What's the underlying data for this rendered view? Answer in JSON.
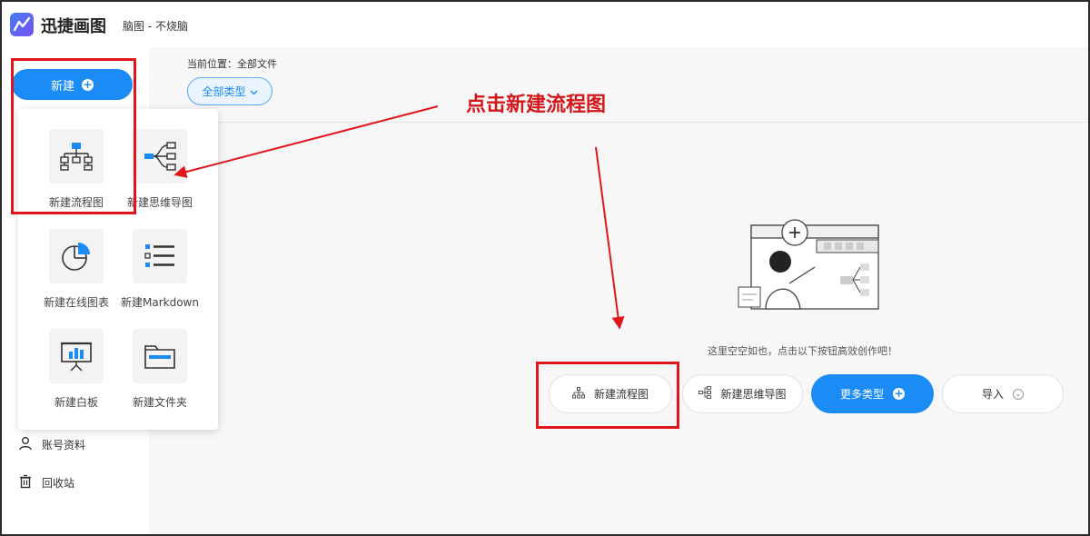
{
  "header": {
    "app_title": "迅捷画图",
    "doc_title": "脑图 - 不烧脑"
  },
  "sidebar": {
    "new_button": "新建",
    "account": "账号资料",
    "trash": "回收站"
  },
  "main": {
    "breadcrumb": "当前位置：全部文件",
    "type_filter": "全部类型",
    "empty_text": "这里空空如也，点击以下按钮高效创作吧！",
    "buttons": {
      "new_flowchart": "新建流程图",
      "new_mindmap": "新建思维导图",
      "more_types": "更多类型",
      "import": "导入"
    }
  },
  "menu": {
    "items": [
      {
        "label": "新建流程图",
        "icon": "flowchart-icon"
      },
      {
        "label": "新建思维导图",
        "icon": "mindmap-icon"
      },
      {
        "label": "新建在线图表",
        "icon": "pie-chart-icon"
      },
      {
        "label": "新建Markdown",
        "icon": "list-icon"
      },
      {
        "label": "新建白板",
        "icon": "whiteboard-icon"
      },
      {
        "label": "新建文件夹",
        "icon": "folder-icon"
      }
    ]
  },
  "annotation": {
    "callout": "点击新建流程图",
    "color": "#e0161b"
  },
  "colors": {
    "accent": "#1b8cf6"
  }
}
